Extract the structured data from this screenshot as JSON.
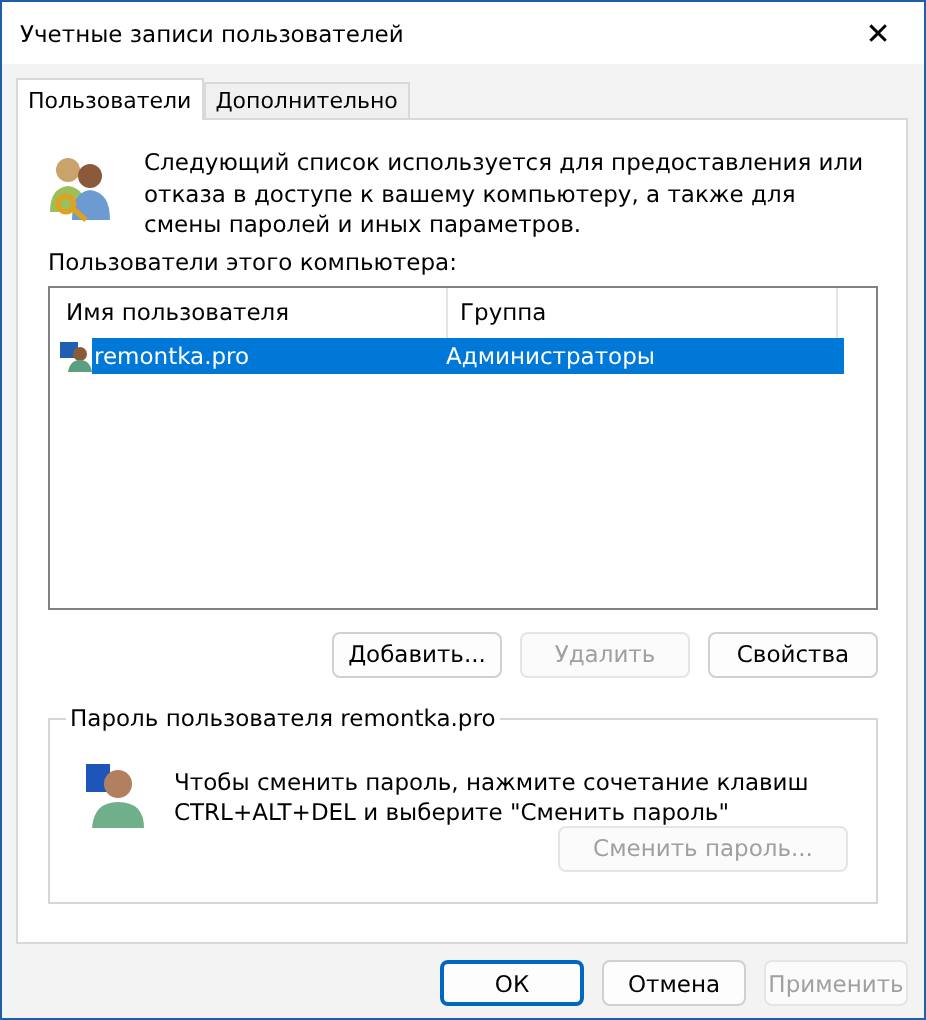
{
  "window": {
    "title": "Учетные записи пользователей",
    "close": "✕"
  },
  "tabs": [
    {
      "label": "Пользователи",
      "selected": true
    },
    {
      "label": "Дополнительно",
      "selected": false
    }
  ],
  "intro": "Следующий список используется для предоставления или отказа в доступе к вашему компьютеру, а также для смены паролей и иных параметров.",
  "users_label": "Пользователи этого компьютера:",
  "table": {
    "columns": [
      "Имя пользователя",
      "Группа"
    ],
    "rows": [
      {
        "name": "remontka.pro",
        "group": "Администраторы",
        "selected": true
      }
    ]
  },
  "list_buttons": [
    {
      "label": "Добавить...",
      "disabled": false
    },
    {
      "label": "Удалить",
      "disabled": true
    },
    {
      "label": "Свойства",
      "disabled": false
    }
  ],
  "password_group": {
    "title": "Пароль пользователя remontka.pro",
    "text": "Чтобы сменить пароль, нажмите сочетание клавиш CTRL+ALT+DEL и выберите \"Сменить пароль\"",
    "button": {
      "label": "Сменить пароль...",
      "disabled": true
    }
  },
  "buttons": [
    {
      "label": "ОК",
      "disabled": false,
      "default": true
    },
    {
      "label": "Отмена",
      "disabled": false,
      "default": false
    },
    {
      "label": "Применить",
      "disabled": true,
      "default": false
    }
  ]
}
